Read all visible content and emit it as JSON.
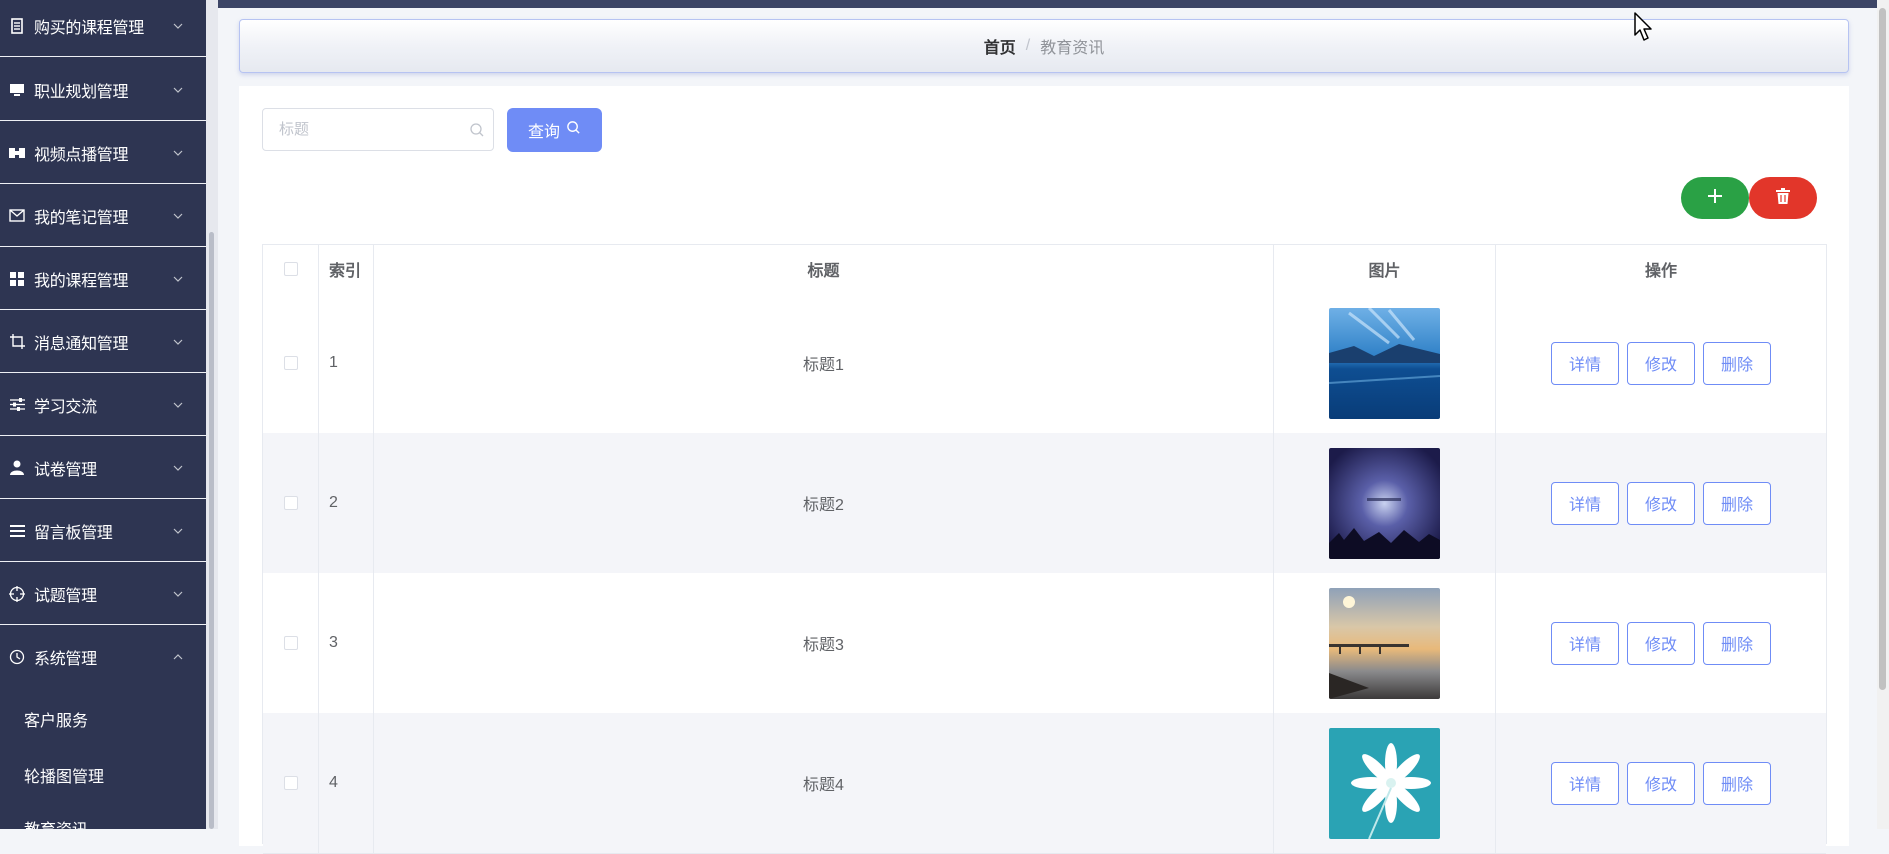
{
  "sidebar": {
    "items": [
      {
        "label": "购买的课程管理",
        "icon": "receipt-icon"
      },
      {
        "label": "职业规划管理",
        "icon": "monitor-icon"
      },
      {
        "label": "视频点播管理",
        "icon": "ticket-icon"
      },
      {
        "label": "我的笔记管理",
        "icon": "mail-icon"
      },
      {
        "label": "我的课程管理",
        "icon": "grid-icon"
      },
      {
        "label": "消息通知管理",
        "icon": "crop-icon"
      },
      {
        "label": "学习交流",
        "icon": "sliders-icon"
      },
      {
        "label": "试卷管理",
        "icon": "user-icon"
      },
      {
        "label": "留言板管理",
        "icon": "list-icon"
      },
      {
        "label": "试题管理",
        "icon": "target-icon"
      },
      {
        "label": "系统管理",
        "icon": "clock-icon"
      }
    ],
    "sub_items": [
      {
        "label": "客户服务"
      },
      {
        "label": "轮播图管理"
      },
      {
        "label": "教育资讯"
      }
    ]
  },
  "breadcrumb": {
    "home": "首页",
    "separator": "/",
    "current": "教育资讯"
  },
  "search": {
    "placeholder": "标题",
    "value": "",
    "button_label": "查询"
  },
  "table": {
    "headers": [
      "索引",
      "标题",
      "图片",
      "操作"
    ],
    "rows": [
      {
        "index": "1",
        "title": "标题1",
        "image": "lake-mountain-photo"
      },
      {
        "index": "2",
        "title": "标题2",
        "image": "night-sky-photo"
      },
      {
        "index": "3",
        "title": "标题3",
        "image": "sunset-bridge-photo"
      },
      {
        "index": "4",
        "title": "标题4",
        "image": "white-flower-photo"
      }
    ],
    "actions": {
      "detail": "详情",
      "edit": "修改",
      "delete": "删除"
    }
  },
  "colors": {
    "sidebar_bg": "#2e3552",
    "primary": "#6f8cf6",
    "success": "#2aa145",
    "danger": "#e2362a"
  }
}
